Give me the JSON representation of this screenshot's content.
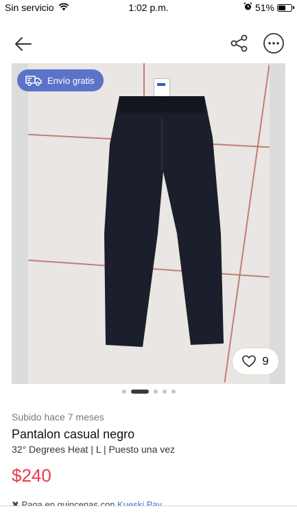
{
  "status_bar": {
    "carrier": "Sin servicio",
    "time": "1:02 p.m.",
    "battery_percent": "51%",
    "battery_level": 0.51,
    "icons": [
      "wifi-icon",
      "alarm-icon",
      "battery-icon"
    ]
  },
  "header": {
    "icons": [
      "back-arrow-icon",
      "share-icon",
      "more-options-icon"
    ]
  },
  "product_image": {
    "badge_label": "Envío gratis",
    "badge_color": "#5b74c9",
    "likes_count": "9",
    "carousel_total": 5,
    "carousel_active": 2
  },
  "product": {
    "uploaded": "Subido hace 7 meses",
    "title": "Pantalon casual negro",
    "meta": "32° Degrees Heat | L | Puesto una vez",
    "price": "$240",
    "price_color": "#e63a4e"
  },
  "payment": {
    "text": "Paga en quincenas con",
    "provider": "Kueski Pay"
  }
}
